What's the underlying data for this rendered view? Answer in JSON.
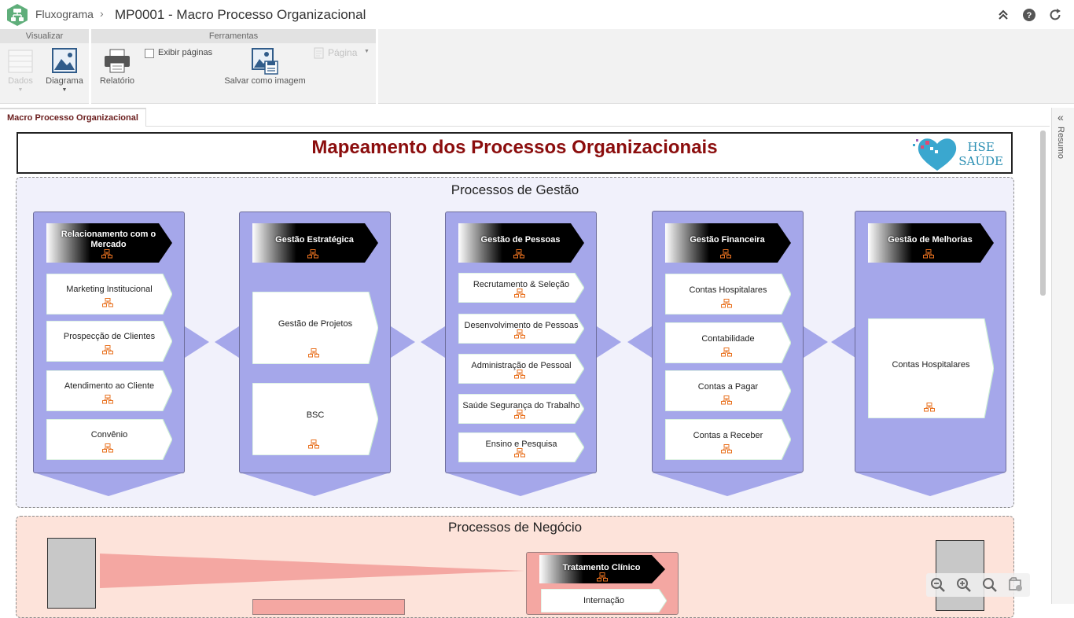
{
  "header": {
    "app_name": "Fluxograma",
    "separator": "›",
    "document_title": "MP0001 - Macro Processo Organizacional"
  },
  "ribbon": {
    "groups": {
      "visualizar": "Visualizar",
      "ferramentas": "Ferramentas"
    },
    "buttons": {
      "dados": "Dados",
      "diagrama": "Diagrama",
      "relatorio": "Relatório",
      "exibir_paginas": "Exibir páginas",
      "salvar_imagem": "Salvar como imagem",
      "pagina": "Página"
    },
    "exibir_paginas_checked": false
  },
  "tabs": [
    {
      "label": "Macro Processo Organizacional",
      "active": true
    }
  ],
  "side_panel": {
    "label": "Resumo"
  },
  "diagram": {
    "title": "Mapeamento dos Processos Organizacionais",
    "logo": {
      "line1": "HSE",
      "line2": "SAÚDE"
    },
    "lanes": {
      "gestao": {
        "title": "Processos de Gestão",
        "columns": [
          {
            "header": "Relacionamento com o Mercado",
            "items": [
              "Marketing Institucional",
              "Prospecção de Clientes",
              "Atendimento ao Cliente",
              "Convênio"
            ]
          },
          {
            "header": "Gestão Estratégica",
            "items": [
              "Gestão de Projetos",
              "BSC"
            ]
          },
          {
            "header": "Gestão de Pessoas",
            "items": [
              "Recrutamento & Seleção",
              "Desenvolvimento de Pessoas",
              "Administração de Pessoal",
              "Saúde Segurança do Trabalho",
              "Ensino e Pesquisa"
            ]
          },
          {
            "header": "Gestão Financeira",
            "items": [
              "Contas Hospitalares",
              "Contabilidade",
              "Contas a Pagar",
              "Contas a Receber"
            ]
          },
          {
            "header": "Gestão de Melhorias",
            "items": [
              "Contas Hospitalares"
            ]
          }
        ]
      },
      "negocio": {
        "title": "Processos de Negócio",
        "columns": [
          {
            "header": "Tratamento Clínico",
            "items": [
              "Internação"
            ]
          }
        ]
      }
    }
  },
  "colors": {
    "title_red": "#8b0d0d",
    "column_fill": "#a5a7ea",
    "lane_gestao_bg": "#f1f1fb",
    "lane_negocio_bg": "#fde3da",
    "process_icon": "#e8711f",
    "logo_blue": "#2b8fb3"
  },
  "icons": {
    "app": "flowchart-app-icon",
    "collapse": "double-chevron-up-icon",
    "help": "help-icon",
    "refresh": "refresh-icon",
    "zoom": [
      "zoom-out-icon",
      "zoom-in-icon",
      "zoom-fit-icon",
      "zoom-settings-icon"
    ]
  }
}
